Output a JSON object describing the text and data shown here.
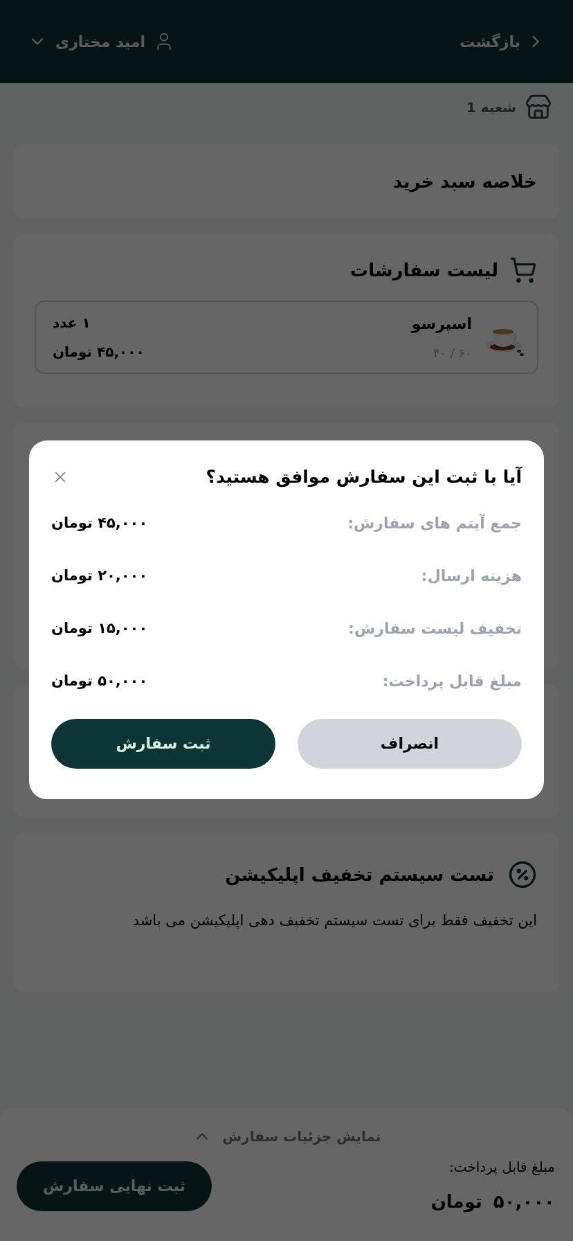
{
  "header": {
    "back_label": "بازگشت",
    "user_name": "امید مختاری"
  },
  "branch": {
    "label": "شعبه 1"
  },
  "cart_summary": {
    "title": "خلاصه سبد خرید"
  },
  "orders": {
    "title": "لیست سفارشات",
    "items": [
      {
        "name": "اسپرسو",
        "stock": "۶۰ / ۴۰",
        "quantity": "۱ عدد",
        "price": "۴۵,۰۰۰ تومان"
      }
    ]
  },
  "discount": {
    "title": "تست سیستم تخفیف اپلیکیشن",
    "description": "این تخفیف فقط برای تست سیستم تخفیف دهی اپلیکیشن می باشد"
  },
  "bottom_bar": {
    "details_toggle": "نمایش جزئیات سفارش",
    "payable_label": "مبلغ قابل پرداخت:",
    "payable_amount": "۵۰,۰۰۰",
    "currency": "تومان",
    "submit": "ثبت نهایی سفارش"
  },
  "dialog": {
    "title": "آیا با ثبت این سفارش موافق هستید؟",
    "rows": [
      {
        "label": "جمع آیتم های سفارش:",
        "value": "۴۵,۰۰۰ تومان"
      },
      {
        "label": "هزینه ارسال:",
        "value": "۲۰,۰۰۰ تومان"
      },
      {
        "label": "تخفیف لیست سفارش:",
        "value": "۱۵,۰۰۰ تومان"
      },
      {
        "label": "مبلغ قابل پرداخت:",
        "value": "۵۰,۰۰۰ تومان"
      }
    ],
    "cancel": "انصراف",
    "confirm": "ثبت سفارش"
  }
}
